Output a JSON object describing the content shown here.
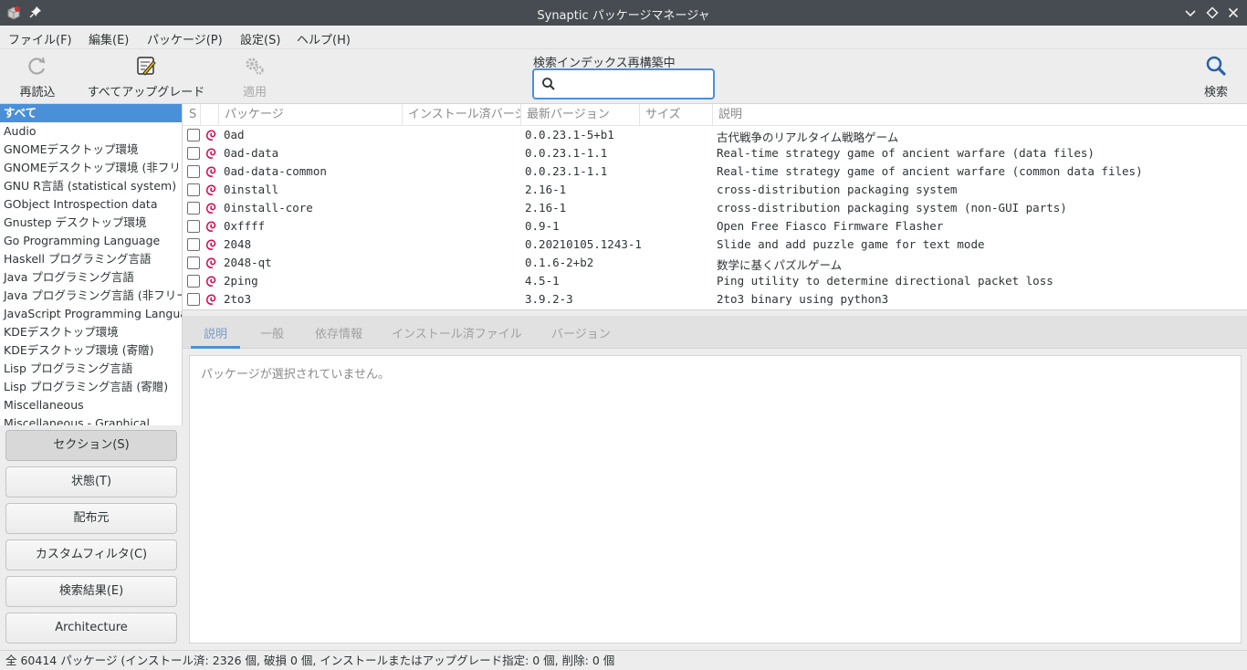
{
  "window": {
    "title": "Synaptic パッケージマネージャ"
  },
  "menubar": {
    "items": [
      "ファイル(F)",
      "編集(E)",
      "パッケージ(P)",
      "設定(S)",
      "ヘルプ(H)"
    ]
  },
  "toolbar": {
    "reload_label": "再読込",
    "upgrade_all_label": "すべてアップグレード",
    "apply_label": "適用",
    "search_label": "検索",
    "search_status": "検索インデックス再構築中",
    "search_value": "",
    "search_placeholder": ""
  },
  "sections": {
    "items": [
      "すべて",
      "Audio",
      "GNOMEデスクトップ環境",
      "GNOMEデスクトップ環境 (非フリー)",
      "GNU R言語 (statistical system)",
      "GObject Introspection data",
      "Gnustep デスクトップ環境",
      "Go Programming Language",
      "Haskell プログラミング言語",
      "Java プログラミング言語",
      "Java プログラミング言語 (非フリー)",
      "JavaScript Programming Language",
      "KDEデスクトップ環境",
      "KDEデスクトップ環境 (寄贈)",
      "Lisp プログラミング言語",
      "Lisp プログラミング言語 (寄贈)",
      "Miscellaneous",
      "Miscellaneous - Graphical"
    ],
    "selected_index": 0
  },
  "filter_buttons": {
    "items": [
      "セクション(S)",
      "状態(T)",
      "配布元",
      "カスタムフィルタ(C)",
      "検索結果(E)",
      "Architecture"
    ],
    "active_index": 0
  },
  "package_table": {
    "headers": {
      "status": "S",
      "package": "パッケージ",
      "installed": "インストール済バージョン",
      "latest": "最新バージョン",
      "size": "サイズ",
      "description": "説明"
    },
    "rows": [
      {
        "name": "0ad",
        "latest": "0.0.23.1-5+b1",
        "description": "古代戦争のリアルタイム戦略ゲーム"
      },
      {
        "name": "0ad-data",
        "latest": "0.0.23.1-1.1",
        "description": "Real-time strategy game of ancient warfare (data files)"
      },
      {
        "name": "0ad-data-common",
        "latest": "0.0.23.1-1.1",
        "description": "Real-time strategy game of ancient warfare (common data files)"
      },
      {
        "name": "0install",
        "latest": "2.16-1",
        "description": "cross-distribution packaging system"
      },
      {
        "name": "0install-core",
        "latest": "2.16-1",
        "description": "cross-distribution packaging system (non-GUI parts)"
      },
      {
        "name": "0xffff",
        "latest": "0.9-1",
        "description": "Open Free Fiasco Firmware Flasher"
      },
      {
        "name": "2048",
        "latest": "0.20210105.1243-1",
        "description": "Slide and add puzzle game for text mode"
      },
      {
        "name": "2048-qt",
        "latest": "0.1.6-2+b2",
        "description": "数学に基くパズルゲーム"
      },
      {
        "name": "2ping",
        "latest": "4.5-1",
        "description": "Ping utility to determine directional packet loss"
      },
      {
        "name": "2to3",
        "latest": "3.9.2-3",
        "description": "2to3 binary using python3"
      }
    ]
  },
  "details": {
    "tabs": [
      "説明",
      "一般",
      "依存情報",
      "インストール済ファイル",
      "バージョン"
    ],
    "active_tab": 0,
    "empty_message": "パッケージが選択されていません。"
  },
  "statusbar": {
    "text": "全 60414 パッケージ (インストール済: 2326 個, 破損 0 個, インストールまたはアップグレード指定: 0 個, 削除: 0 個"
  },
  "colors": {
    "accent": "#4a90d9",
    "titlebar": "#474c52",
    "debian_red": "#d70751"
  },
  "icons": {
    "app": "synaptic-app-icon",
    "reload": "reload-icon",
    "upgrade": "upgrade-icon",
    "apply": "apply-gears-icon",
    "search": "search-magnifier-icon",
    "package": "debian-swirl-icon"
  }
}
